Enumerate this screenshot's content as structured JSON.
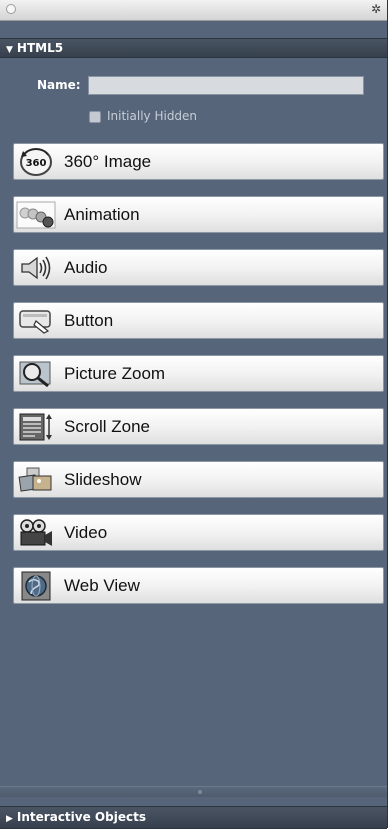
{
  "panel": {
    "section_title": "HTML5",
    "name_label": "Name:",
    "name_value": "",
    "initially_hidden_label": "Initially Hidden",
    "initially_hidden_checked": false
  },
  "objects": [
    {
      "label": "360° Image",
      "icon": "360-image-icon",
      "icon_text": "360"
    },
    {
      "label": "Animation",
      "icon": "animation-icon"
    },
    {
      "label": "Audio",
      "icon": "audio-icon"
    },
    {
      "label": "Button",
      "icon": "button-icon"
    },
    {
      "label": "Picture Zoom",
      "icon": "picture-zoom-icon"
    },
    {
      "label": "Scroll Zone",
      "icon": "scroll-zone-icon"
    },
    {
      "label": "Slideshow",
      "icon": "slideshow-icon"
    },
    {
      "label": "Video",
      "icon": "video-icon"
    },
    {
      "label": "Web View",
      "icon": "web-view-icon"
    }
  ],
  "footer": {
    "section_title": "Interactive Objects"
  },
  "colors": {
    "panel_bg": "#56657a",
    "header_bg": "#3d4654",
    "button_border": "#8e97a4"
  }
}
